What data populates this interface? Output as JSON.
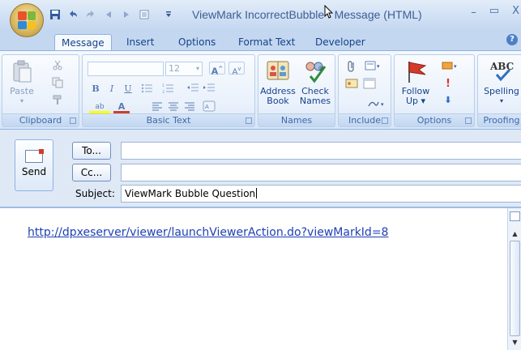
{
  "window": {
    "title": "ViewMark IncorrectBubble - Message (HTML)",
    "controls": {
      "minimize": "–",
      "maximize": "▭",
      "close": "X"
    }
  },
  "quick_access": [
    {
      "icon": "save-icon",
      "glyph": "💾"
    },
    {
      "icon": "undo-icon",
      "glyph": "↶"
    },
    {
      "icon": "redo-icon",
      "glyph": "↷"
    },
    {
      "icon": "previous-icon",
      "glyph": "◂"
    },
    {
      "icon": "next-icon",
      "glyph": "▸"
    },
    {
      "icon": "quick-print-icon",
      "glyph": "▤"
    },
    {
      "icon": "customize-icon",
      "glyph": "▾"
    }
  ],
  "tabs": [
    "Message",
    "Insert",
    "Options",
    "Format Text",
    "Developer"
  ],
  "active_tab": "Message",
  "ribbon": {
    "clipboard": {
      "label": "Clipboard",
      "paste": "Paste"
    },
    "basic_text": {
      "label": "Basic Text",
      "font_size": "12",
      "bold": "B",
      "italic": "I",
      "underline": "U",
      "grow": "A",
      "shrink": "A",
      "highlight": "ab",
      "font_color": "A"
    },
    "names": {
      "label": "Names",
      "address_book_1": "Address",
      "address_book_2": "Book",
      "check_names_1": "Check",
      "check_names_2": "Names"
    },
    "include": {
      "label": "Include"
    },
    "options": {
      "label": "Options",
      "follow_up_1": "Follow",
      "follow_up_2": "Up",
      "importance_high": "!",
      "importance_low": "⬇"
    },
    "proofing": {
      "label": "Proofing",
      "spelling": "Spelling",
      "abc": "ABC"
    }
  },
  "compose": {
    "send_label": "Send",
    "to_label": "To...",
    "cc_label": "Cc...",
    "to_value": "",
    "cc_value": "",
    "subject_label": "Subject:",
    "subject_value": "ViewMark Bubble Question"
  },
  "body": {
    "link_text": "http://dpxeserver/viewer/launchViewerAction.do?viewMarkId=8"
  },
  "colors": {
    "accent": "#15428b",
    "ribbon_bg": "#dfe9f6",
    "link": "#1e3fb4",
    "follow_up_flag": "#d23b2b"
  }
}
